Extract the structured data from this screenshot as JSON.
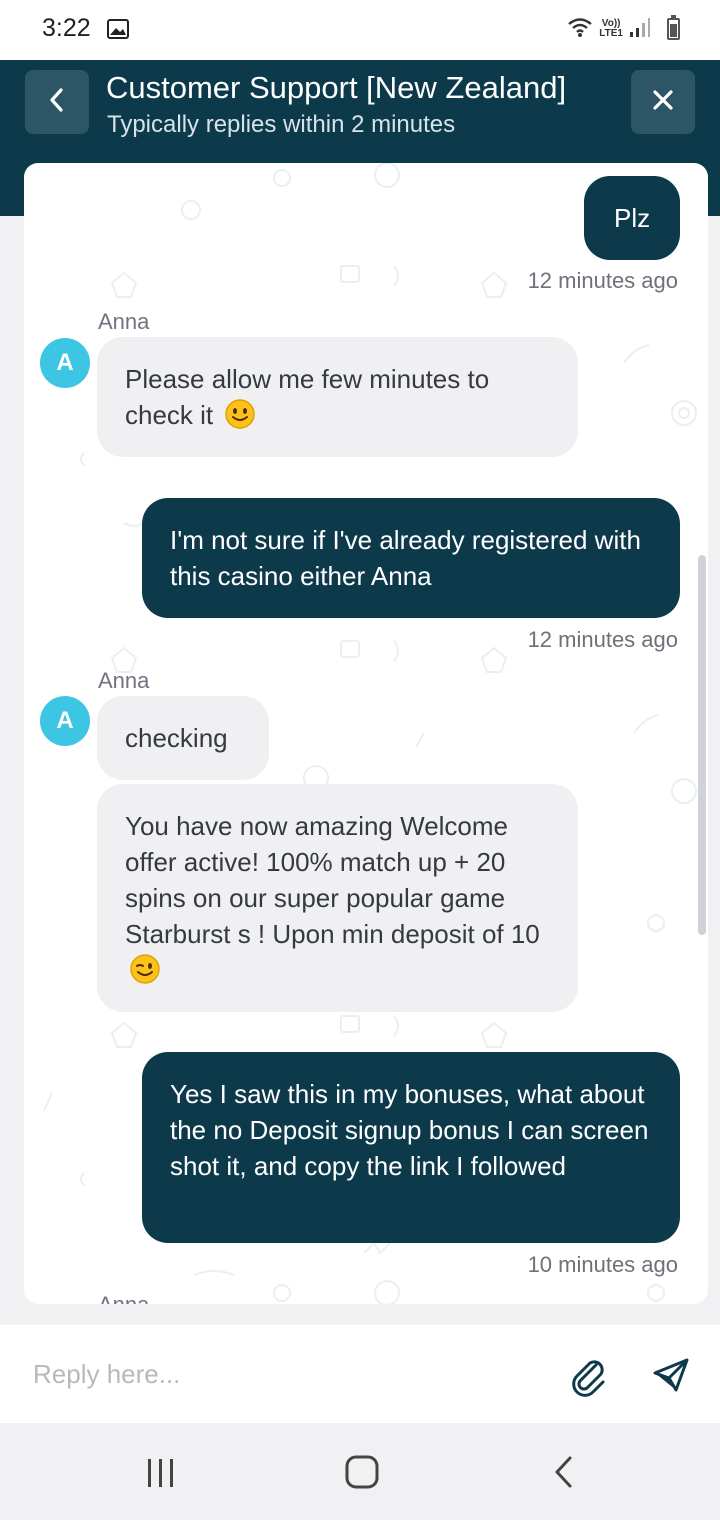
{
  "status_bar": {
    "time": "3:22",
    "network_label_top": "Vo))",
    "network_label_bottom": "LTE1",
    "icons": [
      "gallery-icon",
      "wifi-icon",
      "signal-icon",
      "battery-icon"
    ]
  },
  "header": {
    "title": "Customer Support [New Zealand]",
    "subtitle": "Typically replies within 2 minutes",
    "background_color": "#0d3a4b",
    "back_icon": "chevron-left-icon",
    "close_icon": "close-icon"
  },
  "chat": {
    "messages": [
      {
        "direction": "outgoing",
        "text": "Plz",
        "timestamp": "12 minutes ago"
      },
      {
        "direction": "incoming",
        "sender": "Anna",
        "avatar_letter": "A",
        "text": "Please allow me few minutes to check it",
        "emoji": "slightly-smiling-face"
      },
      {
        "direction": "outgoing",
        "text": "I'm not sure if I've already registered with this casino either Anna",
        "timestamp": "12 minutes ago"
      },
      {
        "direction": "incoming",
        "sender": "Anna",
        "avatar_letter": "A",
        "text": "checking"
      },
      {
        "direction": "incoming",
        "text": "You have now amazing Welcome offer active! 100% match up + 20 spins on our super popular game Starburst s ! Upon min deposit of 10",
        "emoji": "winking-face"
      },
      {
        "direction": "outgoing",
        "text": "Yes I saw this in my bonuses, what about the no Deposit signup bonus I can screen shot it, and copy the link I followed",
        "timestamp": "10 minutes ago"
      },
      {
        "direction": "incoming",
        "sender": "Anna",
        "partially_visible": true
      }
    ],
    "outgoing_color": "#0d3a4b",
    "incoming_color": "#f0f0f2",
    "avatar_color": "#3cc6e4"
  },
  "composer": {
    "placeholder": "Reply here...",
    "value": "",
    "attach_icon": "paperclip-icon",
    "send_icon": "send-icon"
  },
  "nav_bar": {
    "icons": [
      "recent-apps-icon",
      "home-icon",
      "back-icon"
    ]
  }
}
